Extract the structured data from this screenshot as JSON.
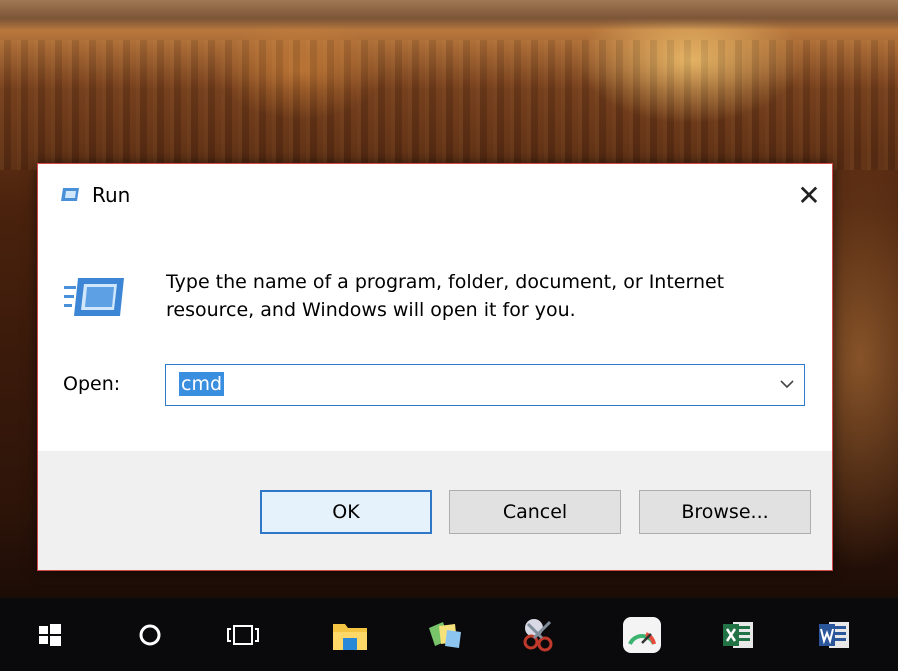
{
  "dialog": {
    "title": "Run",
    "close_glyph": "✕",
    "description_line1": "Type the name of a program, folder, document, or Internet",
    "description_line2": "resource, and Windows will open it for you.",
    "open_label": "Open:",
    "open_value": "cmd",
    "buttons": {
      "ok": "OK",
      "cancel": "Cancel",
      "browse": "Browse..."
    }
  },
  "taskbar": {
    "items": [
      {
        "icon": "windows-start-icon"
      },
      {
        "icon": "cortana-search-icon"
      },
      {
        "icon": "task-view-icon"
      },
      {
        "icon": "file-explorer-icon"
      },
      {
        "icon": "sticky-notes-icon"
      },
      {
        "icon": "snipping-tool-icon"
      },
      {
        "icon": "speedometer-app-icon"
      },
      {
        "icon": "excel-icon"
      },
      {
        "icon": "word-icon"
      }
    ]
  },
  "colors": {
    "accent": "#2f78c8",
    "selection": "#3a8ee0",
    "dialog_border": "#d04848",
    "taskbar": "#0a0a0c"
  }
}
